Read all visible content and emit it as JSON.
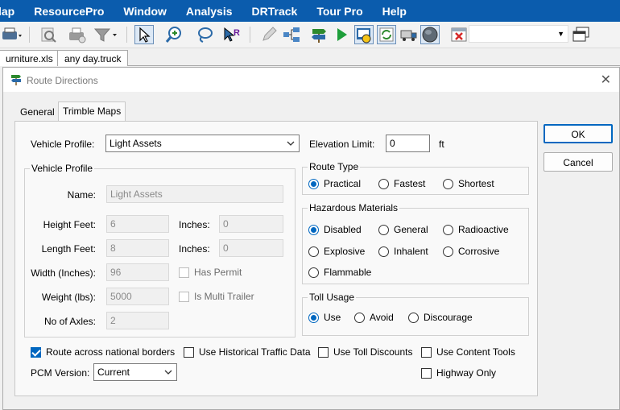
{
  "menu": [
    "lap",
    "ResourcePro",
    "Window",
    "Analysis",
    "DRTrack",
    "Tour Pro",
    "Help"
  ],
  "toolbar": {
    "icons": [
      "map-print-icon",
      "zoom-preview-icon",
      "print-icon",
      "filter-icon",
      "select-pointer-icon",
      "zoom-in-icon",
      "lasso-icon",
      "route-pointer-icon",
      "pencil-icon",
      "tree-view-icon",
      "directions-sign-icon",
      "play-icon",
      "route-directions-icon",
      "refresh-icon",
      "truck-icon",
      "globe-icon",
      "delete-icon"
    ],
    "combo_value": ""
  },
  "doc_tabs": [
    "urniture.xls",
    "any day.truck"
  ],
  "dialog": {
    "title": "Route Directions",
    "tabs": [
      "General",
      "Trimble Maps"
    ],
    "active_tab": "Trimble Maps",
    "ok_label": "OK",
    "cancel_label": "Cancel",
    "vehicle_profile_label": "Vehicle Profile:",
    "vehicle_profile_value": "Light Assets",
    "elevation_label": "Elevation Limit:",
    "elevation_value": "0",
    "elevation_unit": "ft",
    "vp_group": {
      "title": "Vehicle Profile",
      "name_label": "Name:",
      "name_value": "Light Assets",
      "height_label": "Height Feet:",
      "height_value": "6",
      "height_in_label": "Inches:",
      "height_in_value": "0",
      "length_label": "Length  Feet:",
      "length_value": "8",
      "length_in_label": "Inches:",
      "length_in_value": "0",
      "width_label": "Width (Inches):",
      "width_value": "96",
      "permit_label": "Has Permit",
      "weight_label": "Weight (lbs):",
      "weight_value": "5000",
      "multi_label": "Is Multi Trailer",
      "axles_label": "No of Axles:",
      "axles_value": "2"
    },
    "route_type": {
      "title": "Route Type",
      "options": [
        "Practical",
        "Fastest",
        "Shortest"
      ],
      "selected": "Practical"
    },
    "hazmat": {
      "title": "Hazardous Materials",
      "options": [
        "Disabled",
        "General",
        "Radioactive",
        "Explosive",
        "Inhalent",
        "Corrosive",
        "Flammable"
      ],
      "selected": "Disabled"
    },
    "toll": {
      "title": "Toll Usage",
      "options": [
        "Use",
        "Avoid",
        "Discourage"
      ],
      "selected": "Use"
    },
    "options": {
      "national_borders": "Route across national borders",
      "national_borders_checked": true,
      "historical_traffic": "Use Historical Traffic Data",
      "historical_traffic_checked": false,
      "toll_discounts": "Use Toll Discounts",
      "toll_discounts_checked": false,
      "content_tools": "Use Content Tools",
      "content_tools_checked": false,
      "highway_only": "Highway Only",
      "highway_only_checked": false
    },
    "pcm_label": "PCM Version:",
    "pcm_value": "Current"
  }
}
